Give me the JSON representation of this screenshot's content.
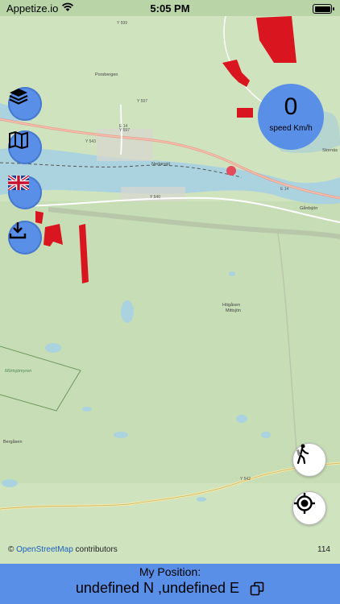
{
  "status": {
    "carrier": "Appetize.io",
    "time": "5:05 PM"
  },
  "speed": {
    "value": "0",
    "unit": "speed Km/h"
  },
  "map": {
    "roads": [
      "Y 599",
      "Y 597",
      "Y 543",
      "E 14",
      "Y 597",
      "Y 540",
      "E 14",
      "Y 542"
    ],
    "places": [
      "Porsbergen",
      "Nedansjö",
      "Högåsen",
      "Mittsjön",
      "Mörtsjömyren",
      "Bergåsen",
      "Stornäs",
      "Gårdsjön"
    ],
    "zoom": "114"
  },
  "attribution": {
    "prefix": "©",
    "link": "OpenStreetMap",
    "suffix": "contributors"
  },
  "position": {
    "label": "My Position:",
    "value": "undefined N ,undefined E"
  },
  "colors": {
    "accent": "#5a8fe8",
    "water": "#aad3df",
    "land": "#cfe3bf",
    "area": "#d9151f"
  },
  "buttons": {
    "layers": "layers-icon",
    "map": "map-icon",
    "language": "uk-flag-icon",
    "download": "download-icon",
    "walk": "walker-icon",
    "locate": "crosshair-icon"
  }
}
